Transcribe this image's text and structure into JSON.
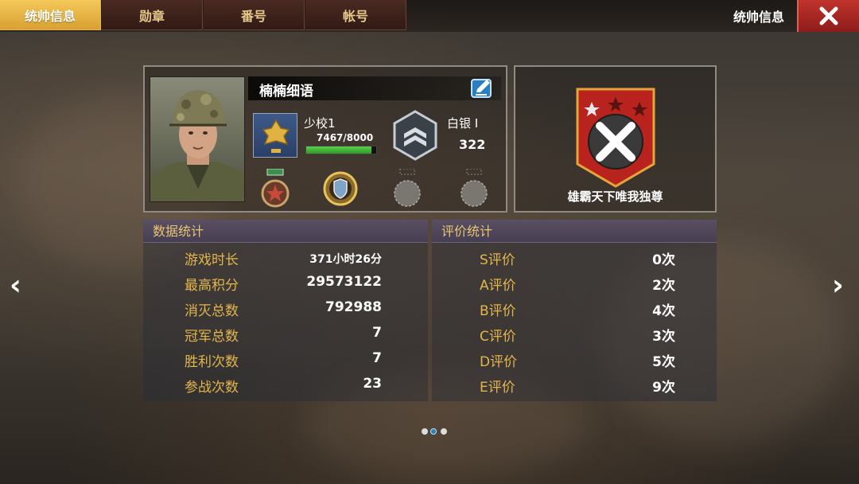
{
  "tabs": [
    {
      "label": "统帅信息",
      "active": true
    },
    {
      "label": "勋章",
      "active": false
    },
    {
      "label": "番号",
      "active": false
    },
    {
      "label": "帐号",
      "active": false
    }
  ],
  "header": {
    "title": "统帅信息",
    "close_icon": "close-icon"
  },
  "profile": {
    "name": "楠楠细语",
    "edit_icon": "edit-icon",
    "rank": "少校1",
    "xp": "7467/8000",
    "xp_progress": 0.933,
    "tier": "白银 I",
    "tier_score": "322",
    "medals": [
      "star-medal-icon",
      "shield-medal-icon",
      "empty-medal-slot-icon",
      "empty-medal-slot-icon"
    ]
  },
  "badge": {
    "title": "雄霸天下唯我独尊",
    "stars": 3,
    "icon": "red-shield-x-icon"
  },
  "data_stats": {
    "title": "数据统计",
    "rows": [
      {
        "label": "游戏时长",
        "value": "371小时26分"
      },
      {
        "label": "最高积分",
        "value": "29573122"
      },
      {
        "label": "消灭总数",
        "value": "792988"
      },
      {
        "label": "冠军总数",
        "value": "7"
      },
      {
        "label": "胜利次数",
        "value": "7"
      },
      {
        "label": "参战次数",
        "value": "23"
      }
    ]
  },
  "rating_stats": {
    "title": "评价统计",
    "rows": [
      {
        "label": "S评价",
        "value": "0次"
      },
      {
        "label": "A评价",
        "value": "2次"
      },
      {
        "label": "B评价",
        "value": "4次"
      },
      {
        "label": "C评价",
        "value": "3次"
      },
      {
        "label": "D评价",
        "value": "5次"
      },
      {
        "label": "E评价",
        "value": "9次"
      }
    ]
  },
  "nav": {
    "prev": "‹",
    "next": "›"
  },
  "pagination": {
    "count": 3,
    "active": 1
  },
  "colors": {
    "accent_gold": "#e3b64c",
    "tab_active": "#f3c95a",
    "close_red": "#c1332d",
    "xp_green": "#3fb630"
  }
}
